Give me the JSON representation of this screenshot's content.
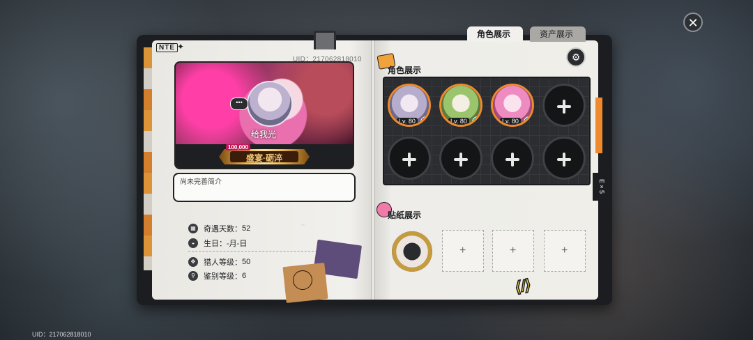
{
  "bottom_uid": "UID：217062818010",
  "close_label": "✕",
  "profile": {
    "logo": "NTE",
    "uid": "UID：217062818010",
    "card_name": "给我光",
    "badge_number": "100,000",
    "title_text": "盛宴·砺淬",
    "bio": "尚未完善简介",
    "stats": [
      {
        "label": "奇遇天数：",
        "value": "52",
        "icon": "calendar-icon"
      },
      {
        "label": "生日：",
        "value": "-月-日",
        "icon": "cake-icon"
      },
      {
        "label": "猎人等级：",
        "value": "50",
        "icon": "hunter-icon"
      },
      {
        "label": "鉴别等级：",
        "value": "6",
        "icon": "magnifier-icon"
      }
    ]
  },
  "tabs": [
    {
      "label": "角色展示",
      "active": true
    },
    {
      "label": "资产展示",
      "active": false
    }
  ],
  "sections": {
    "characters": "角色展示",
    "stickers": "贴纸展示"
  },
  "characters": [
    {
      "level": "Lv. 80",
      "element": "fire",
      "element_color": "#d8283a",
      "colors": [
        "#f2e8f1",
        "#b6accb",
        "#6e6a8e"
      ]
    },
    {
      "level": "Lv. 80",
      "element": "wind",
      "element_color": "#1fae8a",
      "colors": [
        "#f3efe2",
        "#9bc56c",
        "#5e7a3e"
      ]
    },
    {
      "level": "Lv. 80",
      "element": "wind",
      "element_color": "#1fae8a",
      "colors": [
        "#fae3ef",
        "#ee8bc0",
        "#a44a7c"
      ]
    }
  ],
  "empty_slots": 5,
  "sticker_slots": 3,
  "side_tag": "E×5",
  "colors": {
    "accent_orange": "#f08a2c",
    "tab_active_bg": "#f1f0ec",
    "tab_inactive_bg": "#a9a8a4"
  }
}
